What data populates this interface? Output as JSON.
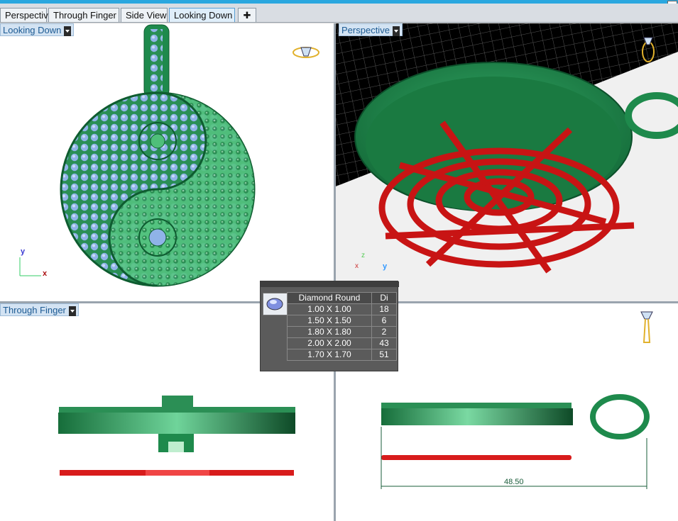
{
  "tabs": [
    {
      "label": "Perspective",
      "active": false
    },
    {
      "label": "Through Finger",
      "active": false
    },
    {
      "label": "Side View",
      "active": false
    },
    {
      "label": "Looking Down",
      "active": true
    }
  ],
  "add_tab_icon": "plus-icon",
  "viewports": {
    "top_left": {
      "label": "Looking Down",
      "axis_y": "y",
      "axis_x": "x"
    },
    "top_right": {
      "label": "Perspective",
      "axis_z": "z",
      "axis_y": "y",
      "axis_x": "x"
    },
    "bottom_left": {
      "label": "Through Finger"
    },
    "bottom_right": {
      "dimension": "48.50"
    }
  },
  "stone_popup": {
    "header": "Diamond Round",
    "header2": "Di",
    "rows": [
      {
        "size": "1.00 X 1.00",
        "qty": "18"
      },
      {
        "size": "1.50 X 1.50",
        "qty": "6"
      },
      {
        "size": "1.80 X 1.80",
        "qty": "2"
      },
      {
        "size": "2.00 X 2.00",
        "qty": "43"
      },
      {
        "size": "1.70 X 1.70",
        "qty": "51"
      }
    ]
  },
  "colors": {
    "accent": "#2aa7df",
    "metal": "#1f8a4c",
    "gem": "#8fb3e8",
    "wax": "#d81c1c"
  }
}
